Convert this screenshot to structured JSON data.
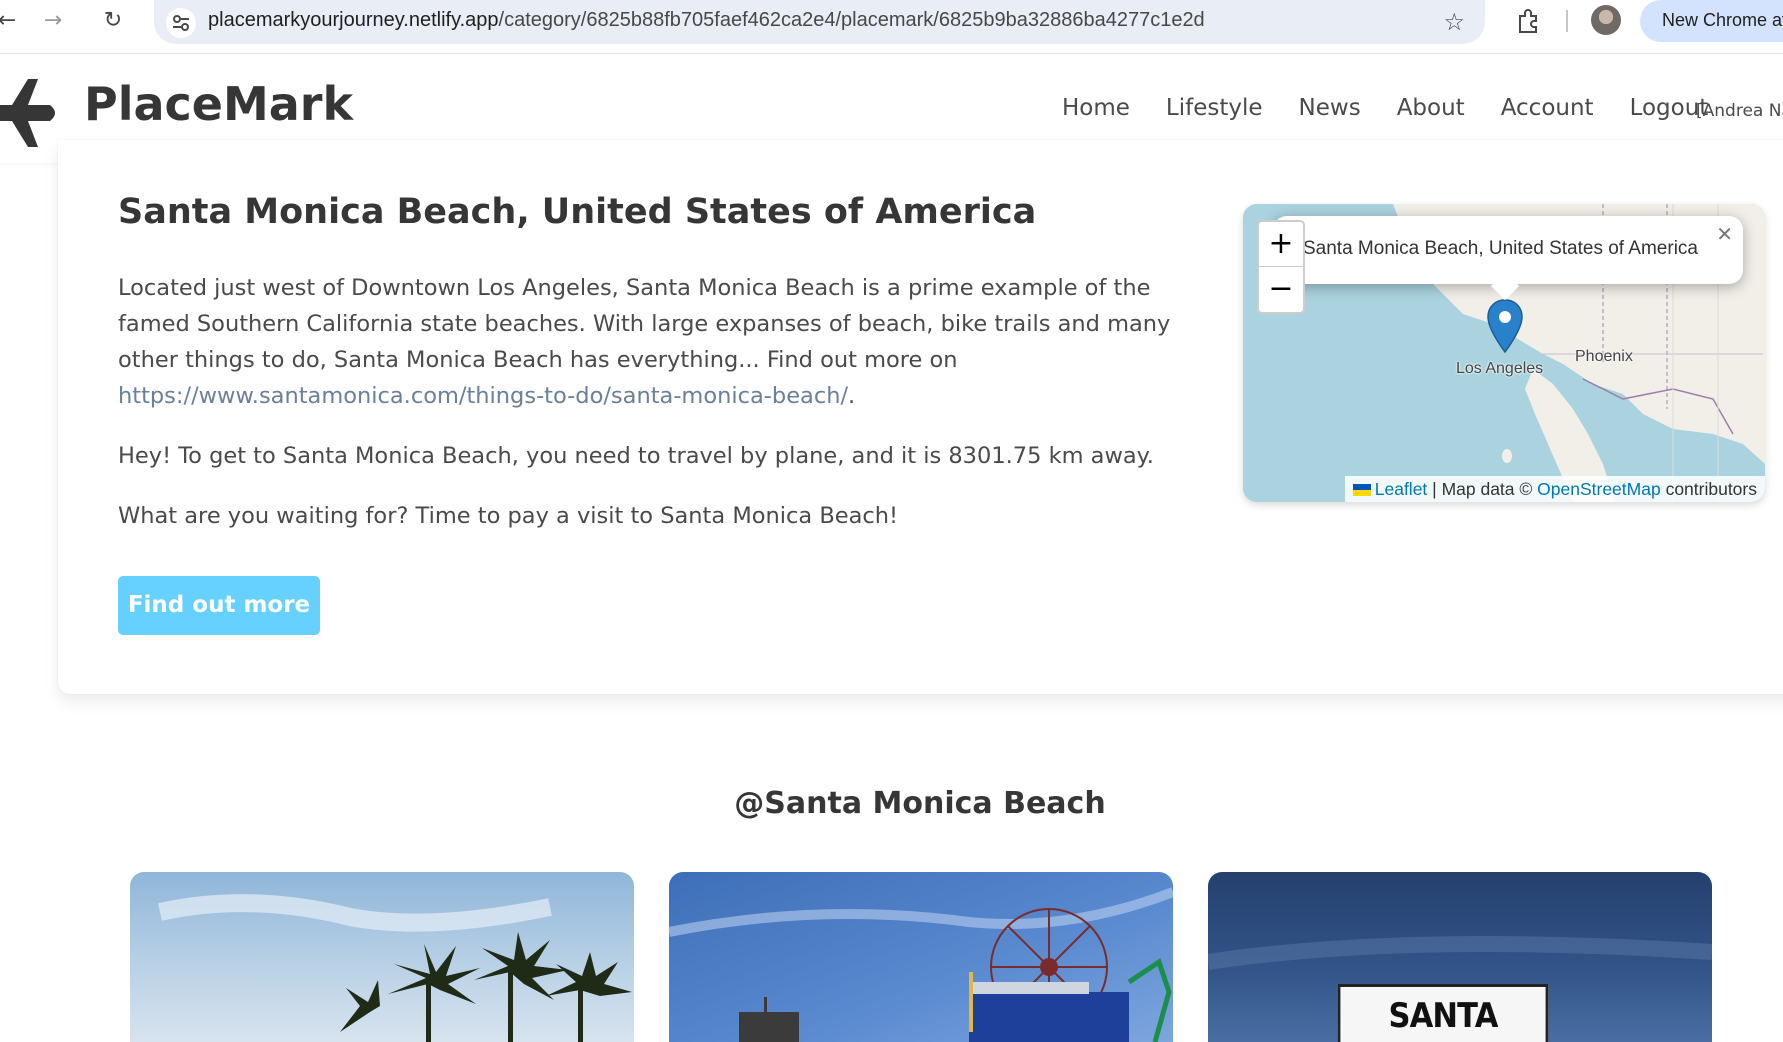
{
  "browser": {
    "url_domain": "placemarkyourjourney.netlify.app",
    "url_path": "/category/6825b88fb705faef462ca2e4/placemark/6825b9ba32886ba4277c1e2d",
    "new_chrome_label": "New Chrome av"
  },
  "header": {
    "brand": "PlaceMark",
    "menu": [
      "Home",
      "Lifestyle",
      "News",
      "About",
      "Account",
      "Logout"
    ],
    "user": "[Andrea Na"
  },
  "placemark": {
    "title": "Santa Monica Beach, United States of America",
    "description": "Located just west of Downtown Los Angeles, Santa Monica Beach is a prime example of the famed Southern California state beaches. With large expanses of beach, bike trails and many other things to do, Santa Monica Beach has everything... Find out more on ",
    "link": "https://www.santamonica.com/things-to-do/santa-monica-beach/",
    "link_suffix": ".",
    "travel": "Hey! To get to Santa Monica Beach, you need to travel by plane, and it is 8301.75 km away.",
    "cta_text": "What are you waiting for? Time to pay a visit to Santa Monica Beach!",
    "button": "Find out more"
  },
  "map": {
    "popup": "Santa Monica Beach, United States of America",
    "zoom_in": "+",
    "zoom_out": "−",
    "labels": {
      "city1": "Los Angeles",
      "city2": "Phoenix"
    },
    "attribution": {
      "leaflet": "Leaflet",
      "sep": " | Map data © ",
      "osm": "OpenStreetMap",
      "contrib": " contributors"
    }
  },
  "gallery": {
    "title": "@Santa Monica Beach",
    "sign_text": "SANTA MONICA"
  },
  "colors": {
    "button": "#66d1ff",
    "link": "#6b7f99",
    "map_water": "#aad3df",
    "map_land": "#f2efe9",
    "pin": "#2a81cb"
  }
}
